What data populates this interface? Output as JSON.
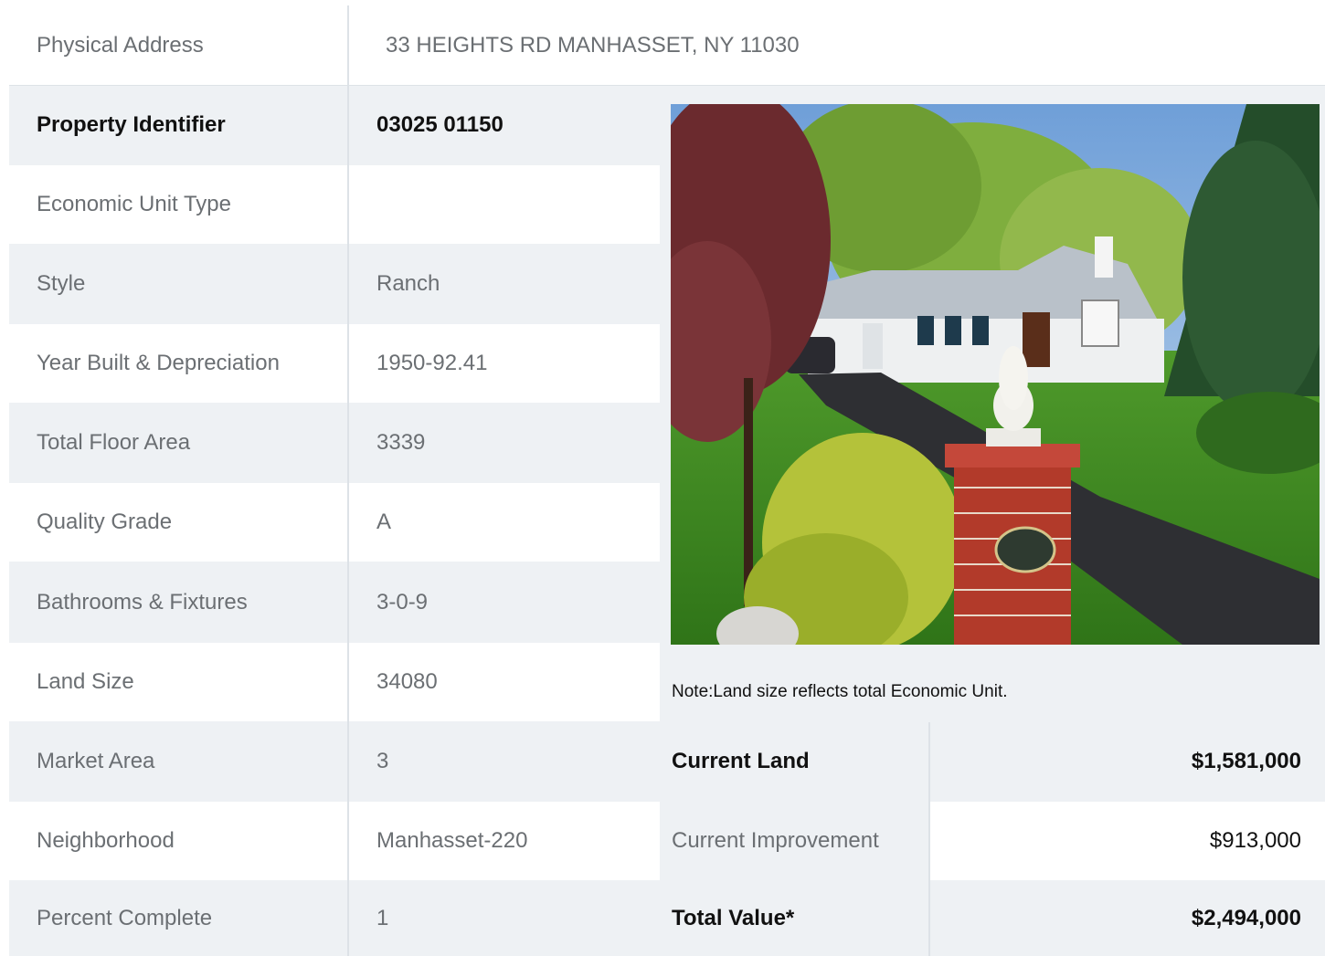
{
  "address": {
    "label": "Physical Address",
    "value": "33  HEIGHTS RD  MANHASSET, NY  11030"
  },
  "details": [
    {
      "label": "Property Identifier",
      "value": "03025  01150",
      "bold": true
    },
    {
      "label": "Economic Unit Type",
      "value": ""
    },
    {
      "label": "Style",
      "value": "Ranch"
    },
    {
      "label": "Year Built & Depreciation",
      "value": "1950-92.41"
    },
    {
      "label": "Total Floor Area",
      "value": "3339"
    },
    {
      "label": "Quality Grade",
      "value": "A"
    },
    {
      "label": "Bathrooms & Fixtures",
      "value": "3-0-9"
    },
    {
      "label": "Land Size",
      "value": "34080"
    },
    {
      "label": "Market Area",
      "value": "3"
    },
    {
      "label": "Neighborhood",
      "value": "Manhasset-220"
    },
    {
      "label": "Percent Complete",
      "value": "1"
    }
  ],
  "note": "Note:Land size reflects total Economic Unit.",
  "values": [
    {
      "label": "Current Land",
      "amount": "$1,581,000"
    },
    {
      "label": "Current Improvement",
      "amount": "$913,000"
    },
    {
      "label": "Total Value*",
      "amount": "$2,494,000"
    }
  ]
}
